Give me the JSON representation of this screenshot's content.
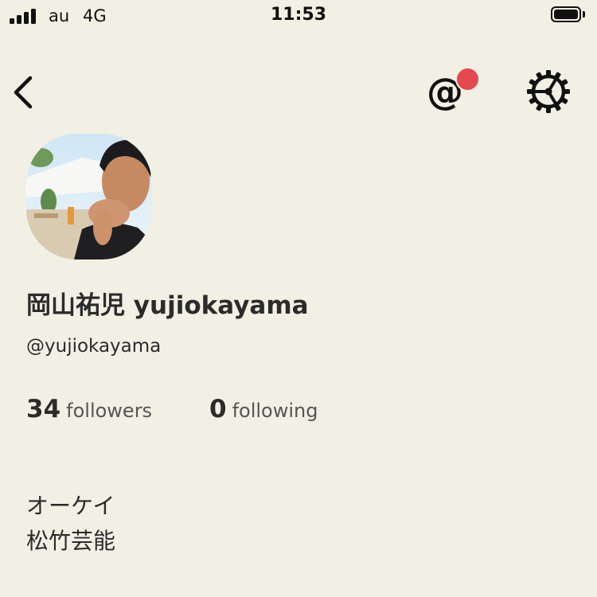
{
  "status_bar": {
    "carrier": "au",
    "network": "4G",
    "time": "11:53"
  },
  "nav": {
    "back_icon": "chevron-left-icon",
    "mention_icon": "at-sign-icon",
    "mention_has_notification": true,
    "settings_icon": "gear-icon"
  },
  "profile": {
    "display_name": "岡山祐児 yujiokayama",
    "username": "@yujiokayama",
    "followers": {
      "count": "34",
      "label": "followers"
    },
    "following": {
      "count": "0",
      "label": "following"
    },
    "bio_lines": [
      "オーケイ",
      "松竹芸能"
    ]
  },
  "colors": {
    "background": "#f2efe4",
    "text": "#2b2b2b",
    "notification_dot": "#e5484d"
  }
}
